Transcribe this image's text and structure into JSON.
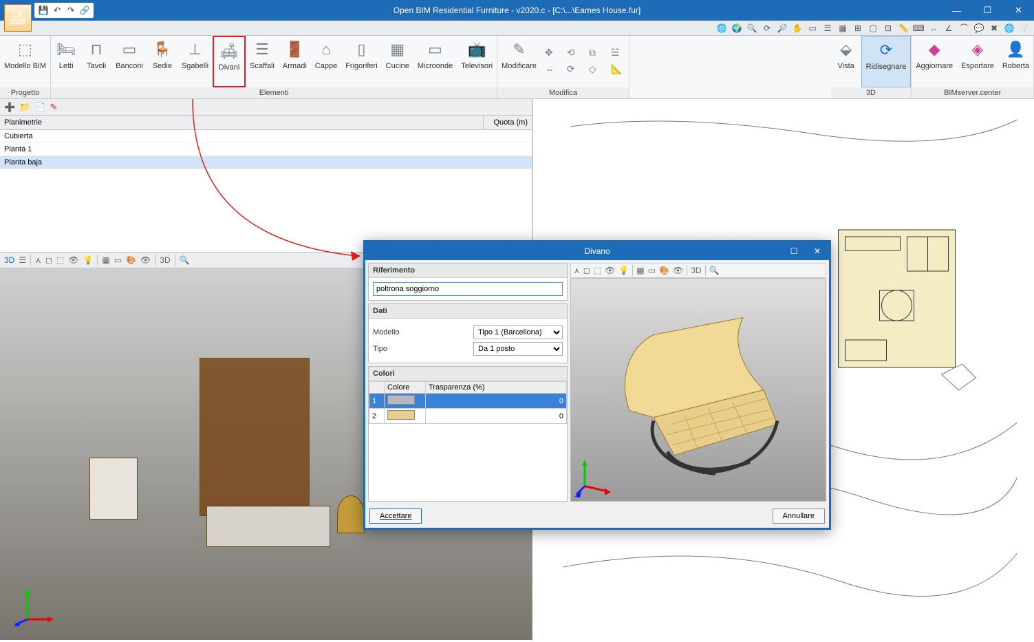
{
  "window": {
    "title": "Open BIM Residential Furniture - v2020.c - [C:\\...\\Eames House.fur]"
  },
  "qat": {
    "save": "save",
    "undo": "undo",
    "redo": "redo",
    "link": "link"
  },
  "ribbon": {
    "groups": {
      "progetto": {
        "label": "Progetto",
        "items": [
          {
            "label": "Modello BIM"
          }
        ]
      },
      "elementi": {
        "label": "Elementi",
        "items": [
          {
            "label": "Letti"
          },
          {
            "label": "Tavoli"
          },
          {
            "label": "Banconi"
          },
          {
            "label": "Sedie"
          },
          {
            "label": "Sgabelli"
          },
          {
            "label": "Divani"
          },
          {
            "label": "Scaffali"
          },
          {
            "label": "Armadi"
          },
          {
            "label": "Cappe"
          },
          {
            "label": "Frigoriferi"
          },
          {
            "label": "Cucine"
          },
          {
            "label": "Microonde"
          },
          {
            "label": "Televisori"
          }
        ]
      },
      "modifica": {
        "label": "Modifica",
        "items": [
          {
            "label": "Modificare"
          }
        ]
      },
      "tre_d": {
        "label": "3D",
        "items": [
          {
            "label": "Vista"
          },
          {
            "label": "Ridisegnare"
          }
        ]
      },
      "bimserver": {
        "label": "BIMserver.center",
        "items": [
          {
            "label": "Aggiornare"
          },
          {
            "label": "Esportare"
          },
          {
            "label": "Roberta"
          }
        ]
      }
    }
  },
  "planimetrie": {
    "header_col1": "Planimetrie",
    "header_col2": "Quota (m)",
    "rows": [
      {
        "name": "Cubierta"
      },
      {
        "name": "Planta 1"
      },
      {
        "name": "Planta baja",
        "selected": true
      }
    ]
  },
  "dialog": {
    "title": "Divano",
    "riferimento_label": "Riferimento",
    "riferimento_value": "poltrona soggiorno",
    "dati_label": "Dati",
    "modello_label": "Modello",
    "modello_value": "Tipo 1 (Barcellona)",
    "tipo_label": "Tipo",
    "tipo_value": "Da 1 posto",
    "colori_label": "Colori",
    "colori_headers": {
      "idx": "",
      "colore": "Colore",
      "trasp": "Trasparenza (%)"
    },
    "colori_rows": [
      {
        "idx": "1",
        "color": "#b7b7c4",
        "trasp": "0",
        "selected": true
      },
      {
        "idx": "2",
        "color": "#e8ce8a",
        "trasp": "0"
      }
    ],
    "accept": "Accettare",
    "cancel": "Annullare"
  }
}
